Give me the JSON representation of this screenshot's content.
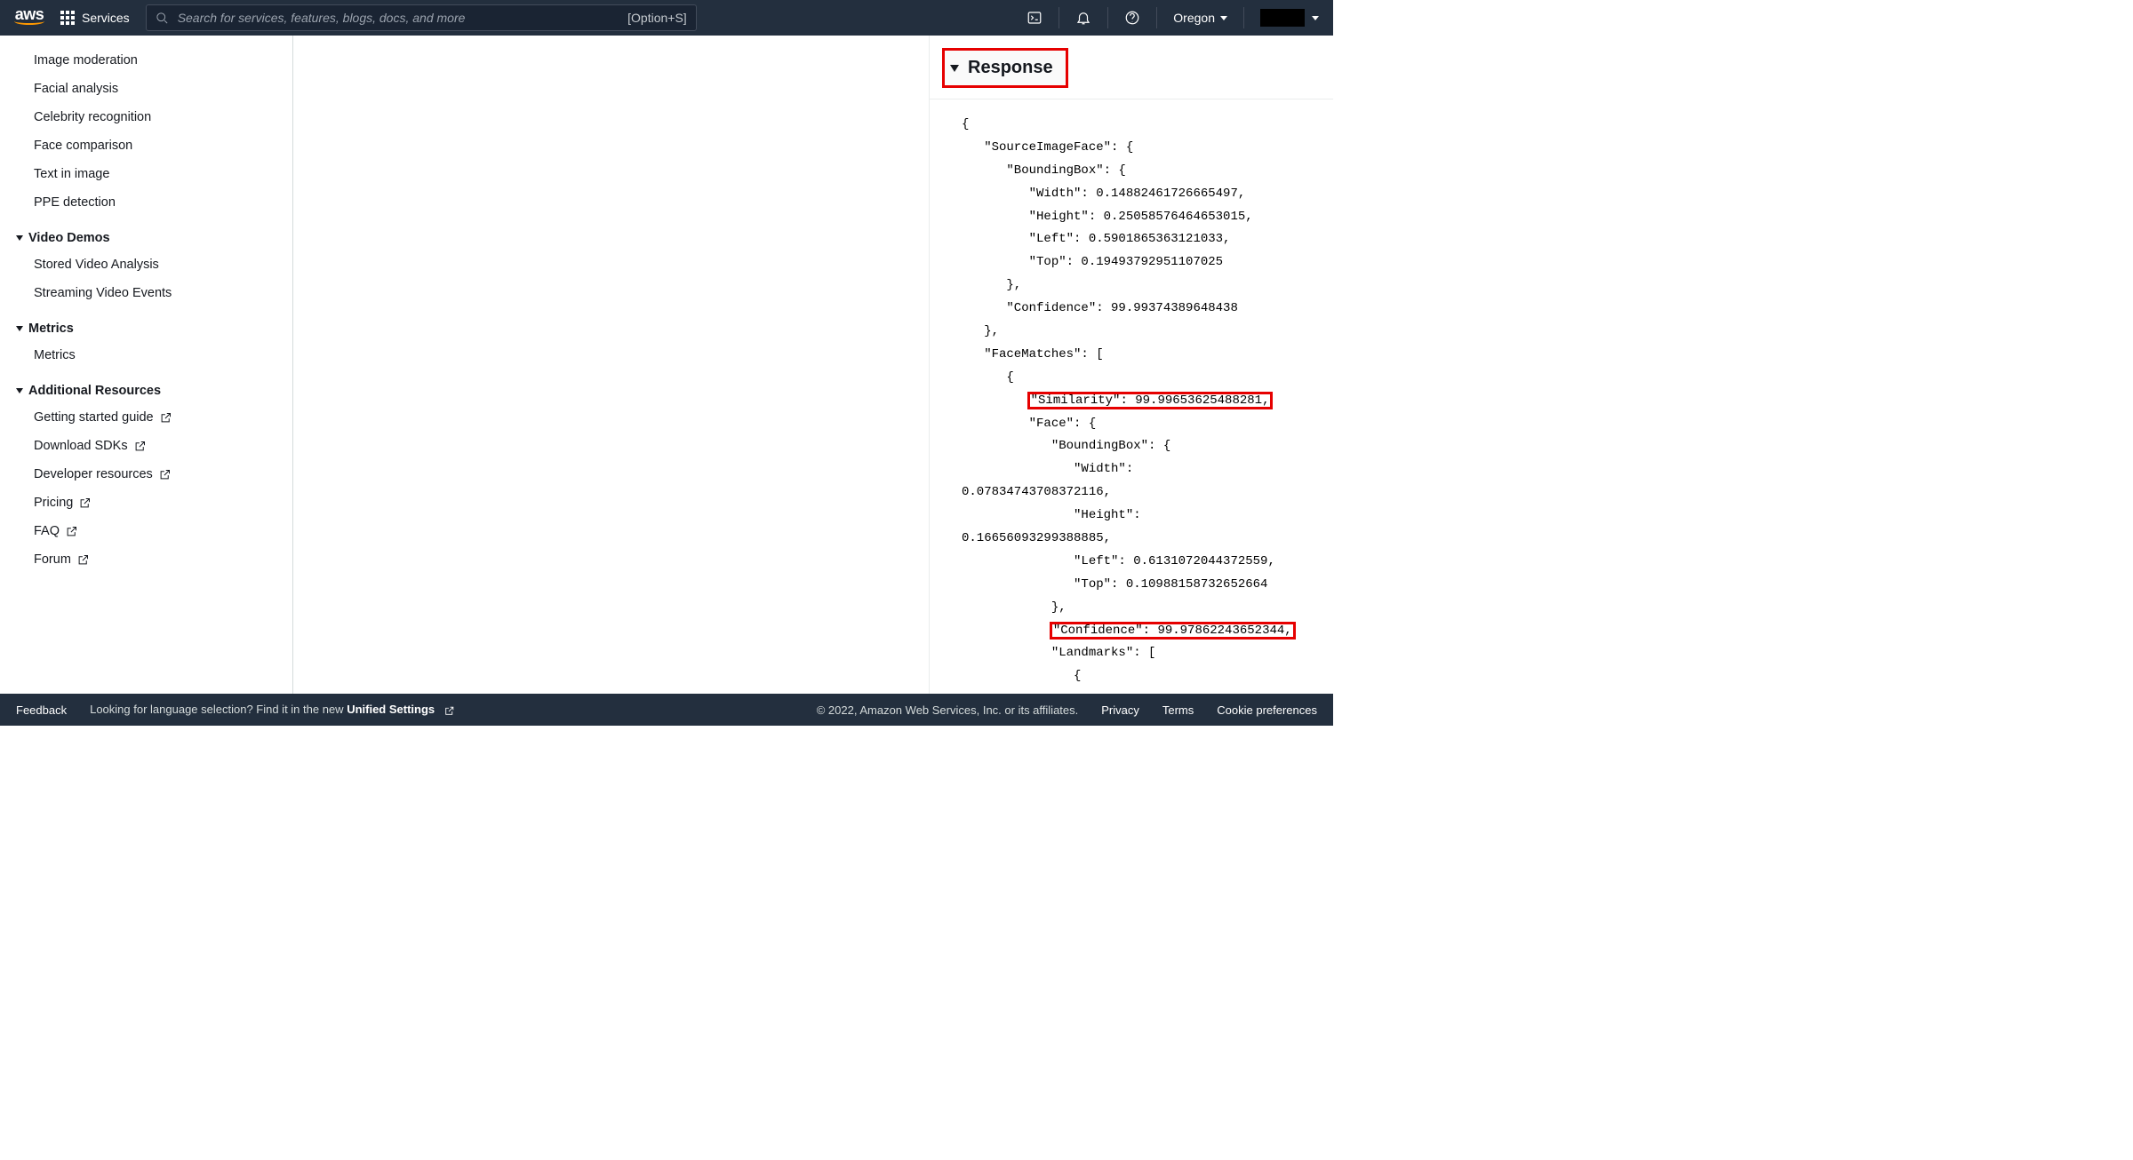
{
  "topbar": {
    "services_label": "Services",
    "search_placeholder": "Search for services, features, blogs, docs, and more",
    "search_shortcut": "[Option+S]",
    "region_label": "Oregon"
  },
  "sidebar": {
    "items_pre": [
      "Image moderation",
      "Facial analysis",
      "Celebrity recognition",
      "Face comparison",
      "Text in image",
      "PPE detection"
    ],
    "section_video": "Video Demos",
    "items_video": [
      "Stored Video Analysis",
      "Streaming Video Events"
    ],
    "section_metrics": "Metrics",
    "items_metrics": [
      "Metrics"
    ],
    "section_additional": "Additional Resources",
    "items_additional": [
      "Getting started guide",
      "Download SDKs",
      "Developer resources",
      "Pricing",
      "FAQ",
      "Forum"
    ]
  },
  "response": {
    "header": "Response",
    "lines": [
      "{",
      "   \"SourceImageFace\": {",
      "      \"BoundingBox\": {",
      "         \"Width\": 0.14882461726665497,",
      "         \"Height\": 0.25058576464653015,",
      "         \"Left\": 0.5901865363121033,",
      "         \"Top\": 0.19493792951107025",
      "      },",
      "      \"Confidence\": 99.99374389648438",
      "   },",
      "   \"FaceMatches\": [",
      "      {",
      "         \"Similarity\": 99.99653625488281,",
      "         \"Face\": {",
      "            \"BoundingBox\": {",
      "               \"Width\": ",
      "0.07834743708372116,",
      "               \"Height\": ",
      "0.16656093299388885,",
      "               \"Left\": 0.6131072044372559,",
      "               \"Top\": 0.10988158732652664",
      "            },",
      "            \"Confidence\": 99.97862243652344,",
      "            \"Landmarks\": [",
      "               {"
    ],
    "highlight_indices": [
      12,
      22
    ]
  },
  "footer": {
    "feedback": "Feedback",
    "lang_text": "Looking for language selection? Find it in the new ",
    "unified": "Unified Settings",
    "copyright": "© 2022, Amazon Web Services, Inc. or its affiliates.",
    "privacy": "Privacy",
    "terms": "Terms",
    "cookies": "Cookie preferences"
  }
}
